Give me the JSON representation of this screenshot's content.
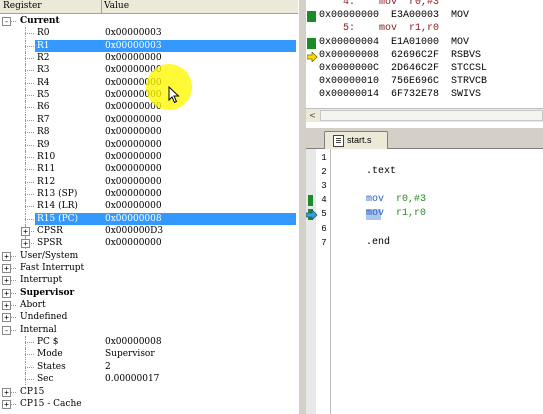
{
  "register_pane": {
    "columns": {
      "register": "Register",
      "value": "Value"
    },
    "rows": [
      {
        "name": "Current",
        "value": "",
        "bold": true,
        "indent": 0,
        "expander": "-",
        "selected": false
      },
      {
        "name": "R0",
        "value": "0x00000003",
        "indent": 1,
        "selected": false
      },
      {
        "name": "R1",
        "value": "0x00000003",
        "indent": 1,
        "selected": true
      },
      {
        "name": "R2",
        "value": "0x00000000",
        "indent": 1,
        "selected": false
      },
      {
        "name": "R3",
        "value": "0x00000000",
        "indent": 1,
        "selected": false
      },
      {
        "name": "R4",
        "value": "0x00000000",
        "indent": 1,
        "selected": false
      },
      {
        "name": "R5",
        "value": "0x00000000",
        "indent": 1,
        "selected": false
      },
      {
        "name": "R6",
        "value": "0x00000000",
        "indent": 1,
        "selected": false
      },
      {
        "name": "R7",
        "value": "0x00000000",
        "indent": 1,
        "selected": false
      },
      {
        "name": "R8",
        "value": "0x00000000",
        "indent": 1,
        "selected": false
      },
      {
        "name": "R9",
        "value": "0x00000000",
        "indent": 1,
        "selected": false
      },
      {
        "name": "R10",
        "value": "0x00000000",
        "indent": 1,
        "selected": false
      },
      {
        "name": "R11",
        "value": "0x00000000",
        "indent": 1,
        "selected": false
      },
      {
        "name": "R12",
        "value": "0x00000000",
        "indent": 1,
        "selected": false
      },
      {
        "name": "R13 (SP)",
        "value": "0x00000000",
        "indent": 1,
        "selected": false
      },
      {
        "name": "R14 (LR)",
        "value": "0x00000000",
        "indent": 1,
        "selected": false
      },
      {
        "name": "R15 (PC)",
        "value": "0x00000008",
        "indent": 1,
        "selected": true
      },
      {
        "name": "CPSR",
        "value": "0x000000D3",
        "indent": 1,
        "expander": "+",
        "selected": false
      },
      {
        "name": "SPSR",
        "value": "0x00000000",
        "indent": 1,
        "expander": "+",
        "selected": false
      },
      {
        "name": "User/System",
        "value": "",
        "indent": 0,
        "expander": "+",
        "selected": false
      },
      {
        "name": "Fast Interrupt",
        "value": "",
        "indent": 0,
        "expander": "+",
        "selected": false
      },
      {
        "name": "Interrupt",
        "value": "",
        "indent": 0,
        "expander": "+",
        "selected": false
      },
      {
        "name": "Supervisor",
        "value": "",
        "bold": true,
        "indent": 0,
        "expander": "+",
        "selected": false
      },
      {
        "name": "Abort",
        "value": "",
        "indent": 0,
        "expander": "+",
        "selected": false
      },
      {
        "name": "Undefined",
        "value": "",
        "indent": 0,
        "expander": "+",
        "selected": false
      },
      {
        "name": "Internal",
        "value": "",
        "indent": 0,
        "expander": "-",
        "selected": false
      },
      {
        "name": "PC  $",
        "value": "0x00000008",
        "indent": 1,
        "selected": false
      },
      {
        "name": "Mode",
        "value": "Supervisor",
        "indent": 1,
        "selected": false
      },
      {
        "name": "States",
        "value": "2",
        "indent": 1,
        "selected": false
      },
      {
        "name": "Sec",
        "value": "0.00000017",
        "indent": 1,
        "selected": false
      },
      {
        "name": "CP15",
        "value": "",
        "indent": 0,
        "expander": "+",
        "selected": false
      },
      {
        "name": "CP15 - Cache",
        "value": "",
        "indent": 0,
        "expander": "+",
        "selected": false
      }
    ]
  },
  "disassembly": {
    "lines": [
      {
        "kind": "src",
        "text": "    4:    mov  r0,#3"
      },
      {
        "kind": "asm",
        "text": "0x00000000  E3A00003  MOV",
        "marker": "green"
      },
      {
        "kind": "src",
        "text": "    5:    mov  r1,r0"
      },
      {
        "kind": "asm",
        "text": "0x00000004  E1A01000  MOV",
        "marker": "green"
      },
      {
        "kind": "asm",
        "text": "0x00000008  62696C2F  RSBVS",
        "marker": "arrow"
      },
      {
        "kind": "asm",
        "text": "0x0000000C  2D646C2F  STCCSL"
      },
      {
        "kind": "asm",
        "text": "0x00000010  756E696C  STRVCB"
      },
      {
        "kind": "asm",
        "text": "0x00000014  6F732E78  SWIVS"
      }
    ],
    "scroll_left_glyph": "<"
  },
  "editor": {
    "tab_label": "start.s",
    "lines": [
      {
        "num": "1",
        "code": []
      },
      {
        "num": "2",
        "code": [
          {
            "t": ".text",
            "c": "plain"
          }
        ]
      },
      {
        "num": "3",
        "code": []
      },
      {
        "num": "4",
        "code": [
          {
            "t": "mov  ",
            "c": "kw"
          },
          {
            "t": "r0,#3",
            "c": "arg"
          }
        ],
        "marker": "green"
      },
      {
        "num": "5",
        "code": [
          {
            "t": "mov  ",
            "c": "kw"
          },
          {
            "t": "r1,r0",
            "c": "arg"
          }
        ],
        "marker": "arrow"
      },
      {
        "num": "6",
        "code": []
      },
      {
        "num": "7",
        "code": [
          {
            "t": ".end",
            "c": "plain"
          }
        ]
      }
    ]
  },
  "colors": {
    "selection": "#3399ff",
    "breakpoint_marker": "#1a8a2a",
    "highlight": "#fff700"
  }
}
